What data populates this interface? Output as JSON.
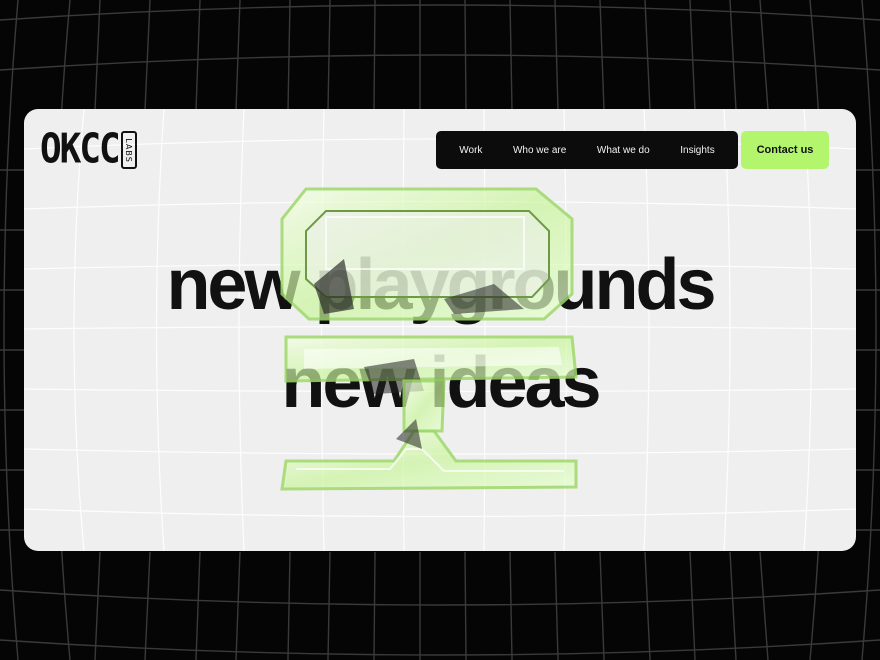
{
  "logo": {
    "main": "OKCC",
    "sub": "LABS"
  },
  "nav": {
    "items": [
      {
        "label": "Work"
      },
      {
        "label": "Who we are"
      },
      {
        "label": "What we do"
      },
      {
        "label": "Insights"
      }
    ],
    "contact_label": "Contact us"
  },
  "hero": {
    "line1": "new playgrounds",
    "line2": "new ideas"
  },
  "colors": {
    "accent": "#b4f56e",
    "nav_bg": "#0c0c0c",
    "card_bg": "#efefef",
    "page_bg": "#050505"
  }
}
